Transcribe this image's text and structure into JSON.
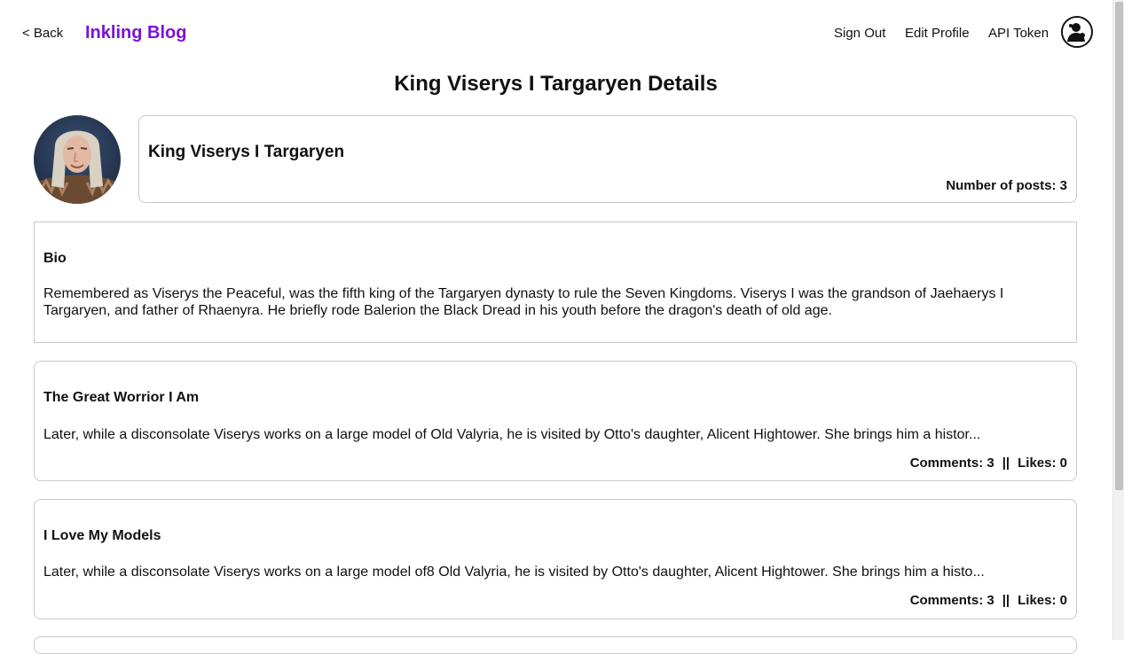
{
  "nav": {
    "back_label": "< Back",
    "brand": "Inkling Blog",
    "sign_out_label": "Sign Out",
    "edit_profile_label": "Edit Profile",
    "api_token_label": "API Token",
    "avatar_icon": "user-avatar-icon"
  },
  "page": {
    "title": "King Viserys I Targaryen Details"
  },
  "profile": {
    "name": "King Viserys I Targaryen",
    "posts_label": "Number of posts: 3",
    "photo_icon": "profile-photo"
  },
  "bio": {
    "heading": "Bio",
    "text": "Remembered as Viserys the Peaceful, was the fifth king of the Targaryen dynasty to rule the Seven Kingdoms. Viserys I was the grandson of Jaehaerys I Targaryen, and father of Rhaenyra. He briefly rode Balerion the Black Dread in his youth before the dragon's death of old age."
  },
  "posts": [
    {
      "title": "The Great Worrior I Am",
      "excerpt": "Later, while a disconsolate Viserys works on a large model of Old Valyria, he is visited by Otto's daughter, Alicent Hightower. She brings him a histor...",
      "comments": "Comments: 3",
      "separator": "||",
      "likes": "Likes: 0"
    },
    {
      "title": "I Love My Models",
      "excerpt": "Later, while a disconsolate Viserys works on a large model of8 Old Valyria, he is visited by Otto's daughter, Alicent Hightower. She brings him a histo...",
      "comments": "Comments: 3",
      "separator": "||",
      "likes": "Likes: 0"
    }
  ],
  "colors": {
    "brand": "#7a12d8",
    "text": "#111111",
    "border": "#c9c9c9"
  }
}
